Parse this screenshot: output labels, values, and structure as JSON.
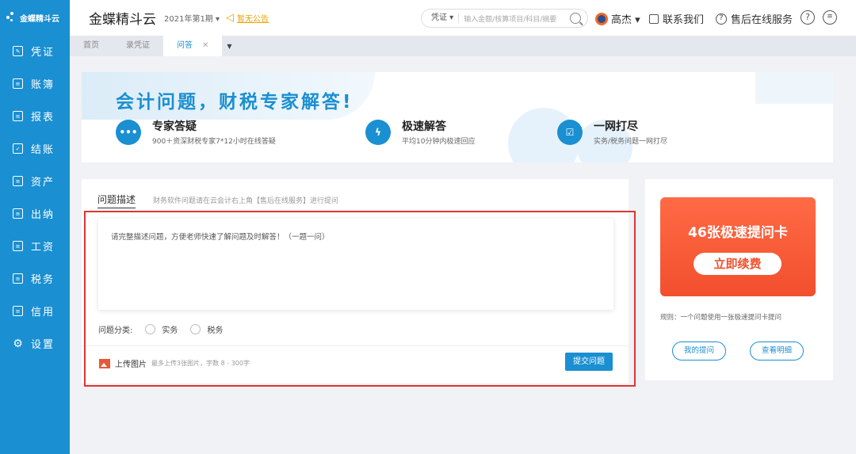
{
  "sidebar": {
    "logo_text": "金蝶精斗云",
    "items": [
      {
        "label": "凭证",
        "icon": "edit-doc-icon"
      },
      {
        "label": "账簿",
        "icon": "book-icon"
      },
      {
        "label": "报表",
        "icon": "report-icon"
      },
      {
        "label": "结账",
        "icon": "checkbox-icon"
      },
      {
        "label": "资产",
        "icon": "asset-icon"
      },
      {
        "label": "出纳",
        "icon": "cashier-icon"
      },
      {
        "label": "工资",
        "icon": "salary-icon"
      },
      {
        "label": "税务",
        "icon": "tax-icon"
      },
      {
        "label": "信用",
        "icon": "credit-icon"
      },
      {
        "label": "设置",
        "icon": "gear-icon"
      }
    ]
  },
  "header": {
    "brand": "金蝶精斗云",
    "period": "2021年第1期 ▾",
    "notice": "暂无公告",
    "search": {
      "type": "凭证 ▾",
      "placeholder": "输入金额/核算项目/科目/摘要"
    },
    "user": "高杰 ▾",
    "contact": "联系我们",
    "after_sales": "售后在线服务",
    "help": "?",
    "menu": "≡"
  },
  "tabs": [
    {
      "label": "首页",
      "active": false
    },
    {
      "label": "录凭证",
      "active": false
    },
    {
      "label": "问答",
      "active": true
    }
  ],
  "banner": {
    "title": "会计问题，财税专家解答!",
    "features": [
      {
        "title": "专家答疑",
        "desc": "900＋资深财税专家7*12小时在线答疑",
        "icon": "chat-icon"
      },
      {
        "title": "极速解答",
        "desc": "平均10分钟内极速回应",
        "icon": "lightning-icon"
      },
      {
        "title": "一网打尽",
        "desc": "实务/税务问题一网打尽",
        "icon": "check-list-icon"
      }
    ]
  },
  "question": {
    "tab_label": "问题描述",
    "tip": "财务软件问题请在云会计右上角【售后在线服务】进行提问",
    "placeholder": "请完整描述问题，方便老师快速了解问题及时解答！（一题一问）",
    "category_label": "问题分类:",
    "categories": [
      "实务",
      "税务"
    ],
    "upload_label": "上传图片",
    "upload_hint": "最多上传3张图片，字数 8 - 300字",
    "submit": "提交问题"
  },
  "card": {
    "title": "46张极速提问卡",
    "renew": "立即续费",
    "rule": "规则：一个问题使用一张极速提问卡提问",
    "my_questions": "我的提问",
    "details": "查看明细"
  },
  "colors": {
    "primary": "#1a8fd1",
    "card": "#f24f2e",
    "highlight": "#e03434"
  }
}
